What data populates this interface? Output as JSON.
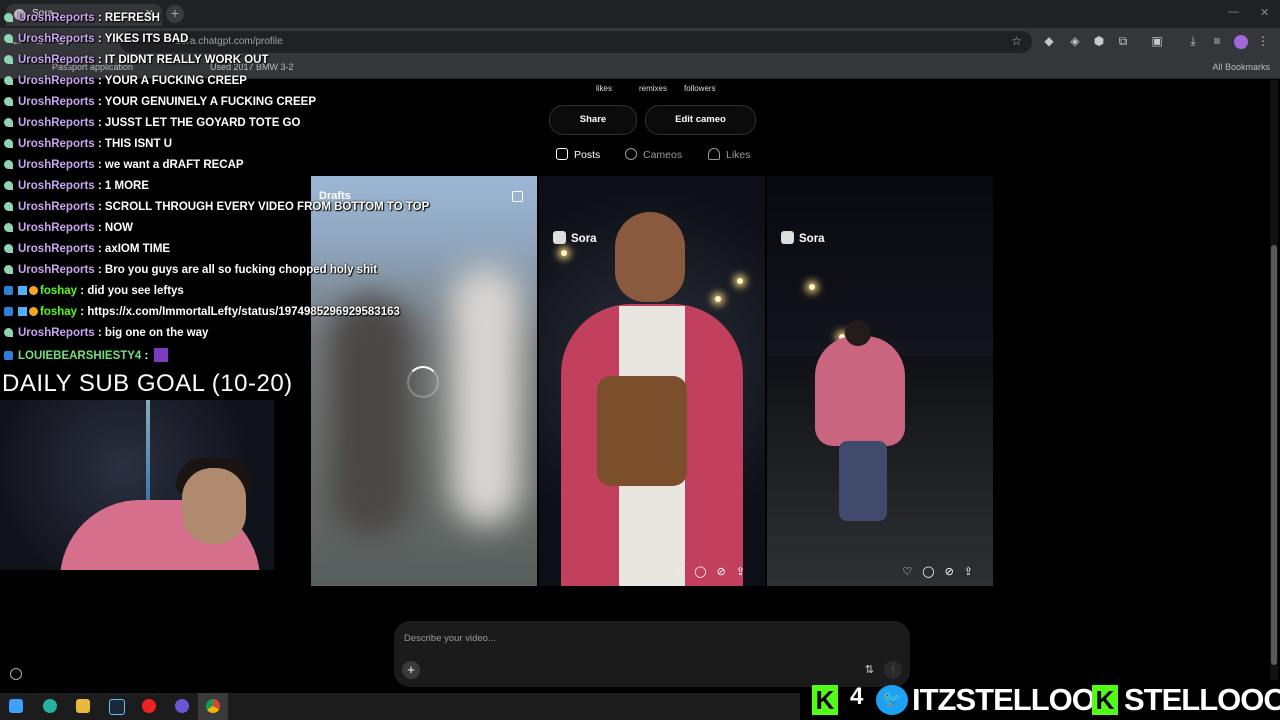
{
  "browser": {
    "tab_title": "Sora",
    "url": "sora.chatgpt.com/profile",
    "bookmarks": [
      "Passport application",
      "Used 2017 BMW 3-2"
    ],
    "all_bookmarks_label": "All Bookmarks"
  },
  "profile": {
    "stats_labels": [
      "likes",
      "remixes",
      "followers"
    ],
    "share_label": "Share",
    "edit_cameo_label": "Edit cameo",
    "tabs": [
      "Posts",
      "Cameos",
      "Likes"
    ],
    "active_tab": "Posts"
  },
  "feed": {
    "drafts_label": "Drafts",
    "sora_label": "Sora"
  },
  "composer": {
    "placeholder": "Describe your video...",
    "plus": "+",
    "tune_icon": "⇅",
    "send_icon": "↑"
  },
  "chat": [
    {
      "user": "UroshReports",
      "message": "REFRESH",
      "user_color": "#c7a4ee"
    },
    {
      "user": "UroshReports",
      "message": "YIKES ITS BAD",
      "user_color": "#c7a4ee"
    },
    {
      "user": "UroshReports",
      "message": "IT DIDNT REALLY WORK OUT",
      "user_color": "#c7a4ee"
    },
    {
      "user": "UroshReports",
      "message": "YOUR A FUCKING CREEP",
      "user_color": "#c7a4ee"
    },
    {
      "user": "UroshReports",
      "message": "YOUR GENUINELY A FUCKING CREEP",
      "user_color": "#c7a4ee"
    },
    {
      "user": "UroshReports",
      "message": "JUSST LET THE GOYARD TOTE GO",
      "user_color": "#c7a4ee"
    },
    {
      "user": "UroshReports",
      "message": "THIS ISNT U",
      "user_color": "#c7a4ee"
    },
    {
      "user": "UroshReports",
      "message": "we want a dRAFT RECAP",
      "user_color": "#c7a4ee"
    },
    {
      "user": "UroshReports",
      "message": "1 MORE",
      "user_color": "#c7a4ee"
    },
    {
      "user": "UroshReports",
      "message": "SCROLL THROUGH EVERY VIDEO FROM BOTTOM TO TOP",
      "user_color": "#c7a4ee"
    },
    {
      "user": "UroshReports",
      "message": "NOW",
      "user_color": "#c7a4ee"
    },
    {
      "user": "UroshReports",
      "message": "axIOM TIME",
      "user_color": "#c7a4ee"
    },
    {
      "user": "UroshReports",
      "message": "Bro you guys are all so fucking chopped holy shit",
      "user_color": "#c7a4ee"
    },
    {
      "user": "foshay",
      "message": "did you see leftys",
      "user_color": "#53fc18"
    },
    {
      "user": "foshay",
      "message": "https://x.com/ImmortalLefty/status/1974985296929583163",
      "user_color": "#53fc18"
    },
    {
      "user": "UroshReports",
      "message": "big one on the way",
      "user_color": "#c7a4ee"
    },
    {
      "user": "LOUIEBEARSHIESTY4",
      "message": "",
      "user_color": "#6fe07b"
    }
  ],
  "overlay": {
    "sub_goal": "DAILY SUB GOAL (10-20)",
    "kick_count": "4",
    "twitter_handle": "ITZSTELLOO",
    "kick_handle": "STELLOOO",
    "kick_letter": "K",
    "bird_icon": "🐦"
  },
  "colors": {
    "kick_green": "#53fc18",
    "twitter_blue": "#1da1f2",
    "chat_user_purple": "#c7a4ee"
  }
}
